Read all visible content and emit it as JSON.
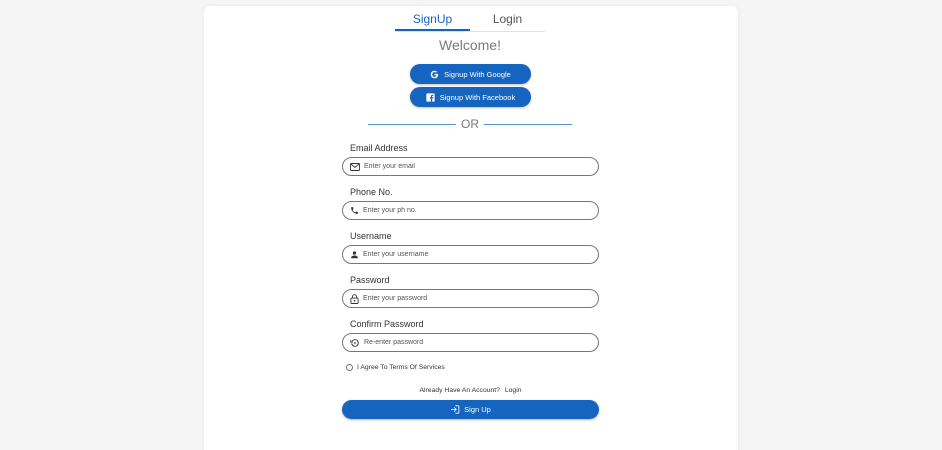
{
  "tabs": [
    {
      "label": "SignUp",
      "active": true
    },
    {
      "label": "Login",
      "active": false
    }
  ],
  "welcome": "Welcome!",
  "social": {
    "google_label": "Signup With Google",
    "google_icon": "google-icon",
    "facebook_label": "Signup With Facebook",
    "facebook_icon": "facebook-icon"
  },
  "divider_text": "OR",
  "fields": {
    "email": {
      "label": "Email Address",
      "placeholder": "Enter your email",
      "icon": "mail-icon",
      "value": ""
    },
    "phone": {
      "label": "Phone No.",
      "placeholder": "Enter your ph no.",
      "icon": "phone-icon",
      "value": ""
    },
    "username": {
      "label": "Username",
      "placeholder": "Enter your username",
      "icon": "person-icon",
      "value": ""
    },
    "password": {
      "label": "Password",
      "placeholder": "Enter your password",
      "icon": "lock-icon",
      "value": ""
    },
    "confirm": {
      "label": "Confirm Password",
      "placeholder": "Re-enter password",
      "icon": "reset-password-icon",
      "value": ""
    }
  },
  "terms_label": "I Agree To Terms Of Services",
  "already": {
    "text": "Already Have An Account?",
    "link": "Login"
  },
  "submit_label": "Sign Up",
  "colors": {
    "accent": "#1565c0",
    "muted": "#7a7a7a",
    "background": "#f5f5f5"
  }
}
